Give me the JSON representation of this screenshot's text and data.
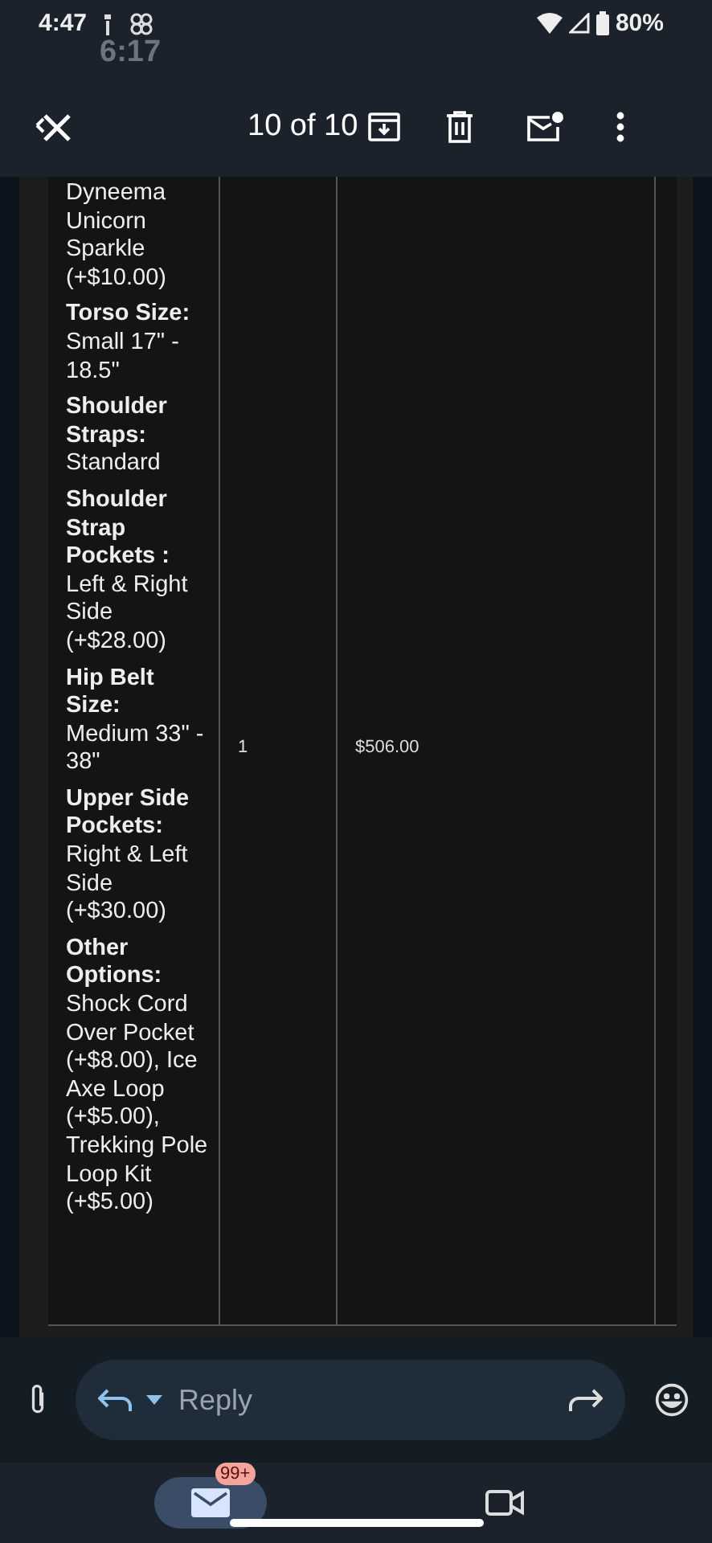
{
  "status_bar": {
    "time": "4:47",
    "ghost_time": "6:17",
    "battery": "80%"
  },
  "app_bar": {
    "counter": "10 of 10"
  },
  "order_item": {
    "options": [
      {
        "value": "Dyneema Unicorn Sparkle (+$10.00)"
      },
      {
        "label": "Torso Size:",
        "value": "Small 17\" - 18.5\""
      },
      {
        "label": "Shoulder Straps:",
        "value": "Standard"
      },
      {
        "label": "Shoulder Strap Pockets :",
        "value": "Left & Right Side (+$28.00)"
      },
      {
        "label": "Hip Belt Size:",
        "value": "Medium 33\" - 38\""
      },
      {
        "label": "Upper Side Pockets:",
        "value": "Right & Left Side (+$30.00)"
      },
      {
        "label": "Other Options:",
        "value": "Shock Cord Over Pocket (+$8.00), Ice Axe Loop (+$5.00), Trekking Pole Loop Kit (+$5.00)"
      }
    ],
    "quantity": "1",
    "price": "$506.00"
  },
  "reply_bar": {
    "placeholder": "Reply"
  },
  "nav": {
    "mail_badge": "99+"
  }
}
